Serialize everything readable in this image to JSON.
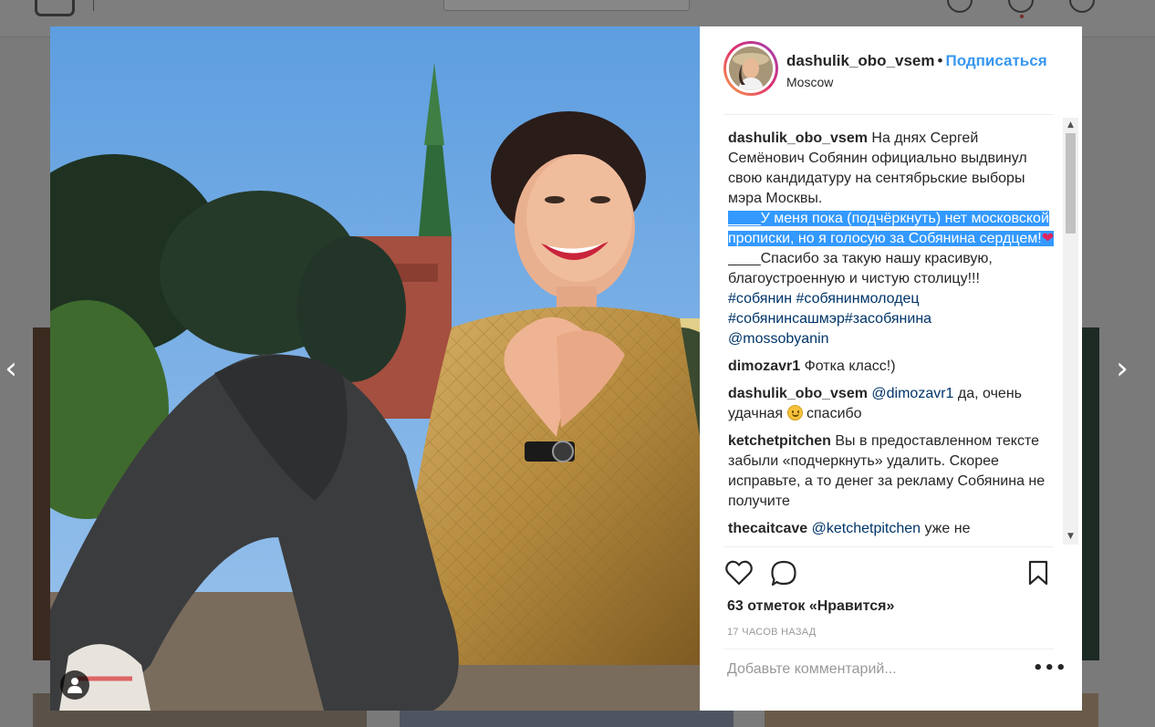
{
  "post": {
    "username": "dashulik_obo_vsem",
    "separator": "•",
    "follow_label": "Подписаться",
    "location": "Moscow"
  },
  "caption": {
    "username": "dashulik_obo_vsem",
    "text_before": "На днях Сергей Семёнович Собянин официально выдвинул свою кандидатуру на сентябрьские выборы мэра Москвы.",
    "highlighted": "____У меня пока (подчёркнуть) нет московской прописки, но я голосую за Собянина сердцем!",
    "heart": "❤",
    "text_after": "____Спасибо за такую нашу красивую, благоустроенную и чистую столицу!!!",
    "hashtags": [
      "#собянин",
      "#собянинмолодец",
      "#собянинсашмэр",
      "#засобянина"
    ],
    "mention": "@mossobyanin"
  },
  "comments": [
    {
      "username": "dimozavr1",
      "text": "Фотка класс!)"
    },
    {
      "username": "dashulik_obo_vsem",
      "mention": "@dimozavr1",
      "text_a": "да, очень удачная",
      "text_b": "спасибо"
    },
    {
      "username": "ketchetpitchen",
      "text": "Вы в предоставленном тексте забыли «подчеркнуть» удалить. Скорее исправьте, а то денег за рекламу Собянина не получите"
    },
    {
      "username": "thecaitcave",
      "mention": "@ketchetpitchen",
      "text": "уже не"
    }
  ],
  "footer": {
    "likes": "63 отметок «Нравится»",
    "time": "17 ЧАСОВ НАЗАД",
    "comment_placeholder": "Добавьте комментарий...",
    "more": "•••"
  },
  "nav": {
    "prev": "‹",
    "next": "›"
  },
  "icons": {
    "like": "heart-outline-icon",
    "comment": "speech-bubble-icon",
    "save": "bookmark-icon",
    "user_tag": "person-icon"
  },
  "colors": {
    "link": "#003569",
    "follow": "#3897f0",
    "selection": "#3399ff"
  }
}
